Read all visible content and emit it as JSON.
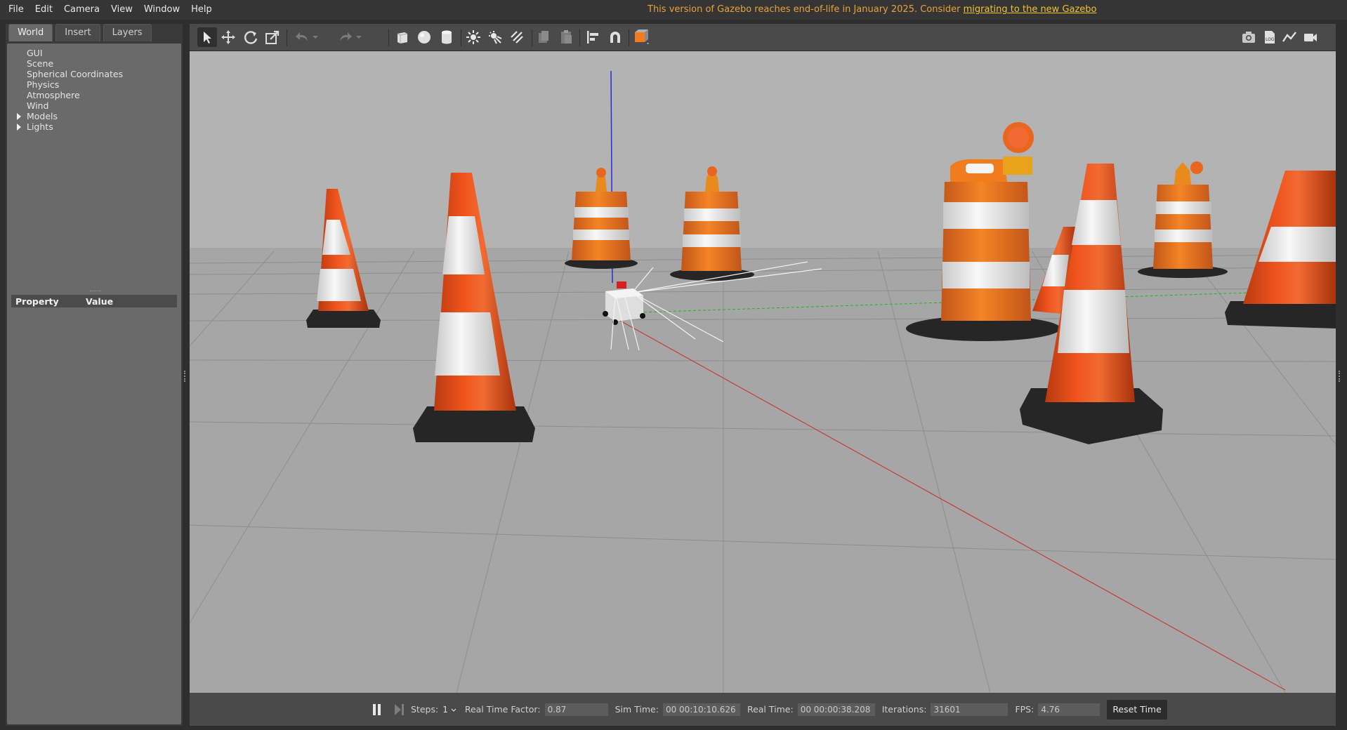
{
  "menu": [
    "File",
    "Edit",
    "Camera",
    "View",
    "Window",
    "Help"
  ],
  "notice": {
    "text": "This version of Gazebo reaches end-of-life in January 2025. Consider ",
    "link": "migrating to the new Gazebo"
  },
  "left_panel": {
    "tabs": [
      "World",
      "Insert",
      "Layers"
    ],
    "tree": [
      {
        "label": "GUI",
        "expandable": false
      },
      {
        "label": "Scene",
        "expandable": false
      },
      {
        "label": "Spherical Coordinates",
        "expandable": false
      },
      {
        "label": "Physics",
        "expandable": false
      },
      {
        "label": "Atmosphere",
        "expandable": false
      },
      {
        "label": "Wind",
        "expandable": false
      },
      {
        "label": "Models",
        "expandable": true
      },
      {
        "label": "Lights",
        "expandable": true
      }
    ],
    "property_header": {
      "property": "Property",
      "value": "Value"
    }
  },
  "toolbar": {
    "left_icons": [
      "select-arrow-icon",
      "translate-icon",
      "rotate-icon",
      "scale-icon",
      "undo-icon",
      "redo-icon",
      "box-icon",
      "sphere-icon",
      "cylinder-icon",
      "point-light-icon",
      "spot-light-icon",
      "directional-light-icon",
      "copy-icon",
      "paste-icon",
      "align-icon",
      "snap-icon",
      "view-angle-icon"
    ],
    "right_icons": [
      "screenshot-icon",
      "log-icon",
      "plot-icon",
      "record-video-icon"
    ]
  },
  "bottom_bar": {
    "steps_label": "Steps:",
    "steps_value": "1",
    "rtf_label": "Real Time Factor:",
    "rtf_value": "0.87",
    "sim_time_label": "Sim Time:",
    "sim_time_value": "00 00:10:10.626",
    "real_time_label": "Real Time:",
    "real_time_value": "00 00:00:38.208",
    "iterations_label": "Iterations:",
    "iterations_value": "31601",
    "fps_label": "FPS:",
    "fps_value": "4.76",
    "reset_label": "Reset Time"
  },
  "colors": {
    "accent_notice": "#e8a23a",
    "cone_orange": "#f0531d",
    "barrel_orange": "#f07c1e",
    "ground": "#a6a6a6",
    "sky": "#b3b3b3"
  }
}
